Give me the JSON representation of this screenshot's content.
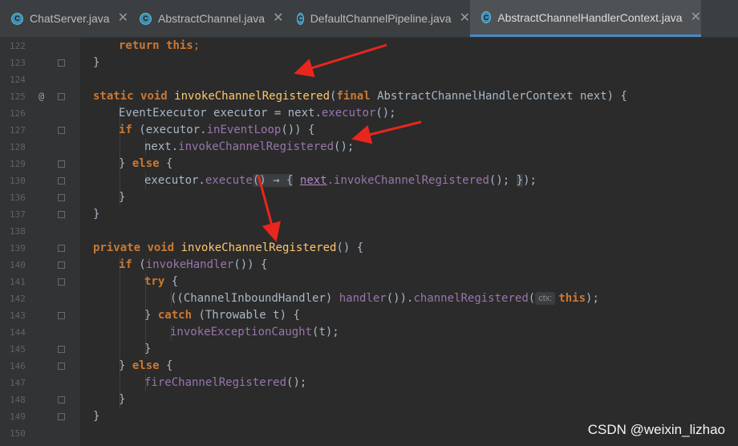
{
  "tabs": [
    {
      "label": "ChatServer.java",
      "icon": "java-class-run-icon",
      "active": false
    },
    {
      "label": "AbstractChannel.java",
      "icon": "java-class-icon",
      "active": false
    },
    {
      "label": "DefaultChannelPipeline.java",
      "icon": "java-class-icon",
      "active": false
    },
    {
      "label": "AbstractChannelHandlerContext.java",
      "icon": "java-class-icon",
      "active": true
    }
  ],
  "tab_close_glyph": "✕",
  "line_numbers": [
    "122",
    "123",
    "124",
    "125",
    "126",
    "127",
    "128",
    "129",
    "130",
    "136",
    "137",
    "138",
    "139",
    "140",
    "141",
    "142",
    "143",
    "144",
    "145",
    "146",
    "147",
    "148",
    "149",
    "150"
  ],
  "gutter_override_marker": "@",
  "code": {
    "l122": {
      "kw": "return",
      "this": "this",
      "end": ";"
    },
    "l123": {
      "text": "}"
    },
    "l125": {
      "static": "static",
      "void": "void",
      "name": "invokeChannelRegistered",
      "paren_open": "(",
      "final": "final",
      "type": "AbstractChannelHandlerContext",
      "param": "next",
      "paren_close": ")",
      "brace": "{"
    },
    "l126": {
      "type": "EventExecutor",
      "rest": "executor = next.",
      "call": "executor",
      "end": "();"
    },
    "l127": {
      "kw": "if",
      "open": "(executor.",
      "call": "inEventLoop",
      "end": "()) {"
    },
    "l128": {
      "prefix": "next.",
      "call": "invokeChannelRegistered",
      "end": "();"
    },
    "l129": {
      "pre": "} ",
      "kw": "else",
      "post": " {"
    },
    "l130": {
      "prefix": "executor.",
      "call": "execute",
      "collapsed": "() → {",
      "next": "next",
      "mid": ".invokeChannelRegistered",
      "paren": "();",
      "collapsed_end": "}",
      "end": ");"
    },
    "l136": {
      "text": "}"
    },
    "l137": {
      "text": "}"
    },
    "l139": {
      "private": "private",
      "void": "void",
      "name": "invokeChannelRegistered",
      "end": "() {"
    },
    "l140": {
      "kw": "if",
      "open": "(",
      "call": "invokeHandler",
      "end": "()) {"
    },
    "l141": {
      "kw": "try",
      "end": " {"
    },
    "l142": {
      "open": "((",
      "type": "ChannelInboundHandler",
      "mid": ") ",
      "call": "handler",
      "mid2": "()).",
      "call2": "channelRegistered",
      "paren": "(",
      "hint": "ctx:",
      "this": "this",
      "end": ");"
    },
    "l143": {
      "pre": "} ",
      "kw": "catch",
      "open": " (",
      "type": "Throwable",
      "param": " t) {"
    },
    "l144": {
      "call": "invokeExceptionCaught",
      "end": "(t);"
    },
    "l145": {
      "text": "}"
    },
    "l146": {
      "pre": "} ",
      "kw": "else",
      "post": " {"
    },
    "l147": {
      "call": "fireChannelRegistered",
      "end": "();"
    },
    "l148": {
      "text": "}"
    },
    "l149": {
      "text": "}"
    }
  },
  "watermark": "CSDN @weixin_lizhao",
  "colors": {
    "accent_tab_underline": "#4a88c7",
    "arrow": "#e8261d",
    "keyword": "#cc7832",
    "method": "#ffc66d",
    "field": "#9876aa"
  }
}
